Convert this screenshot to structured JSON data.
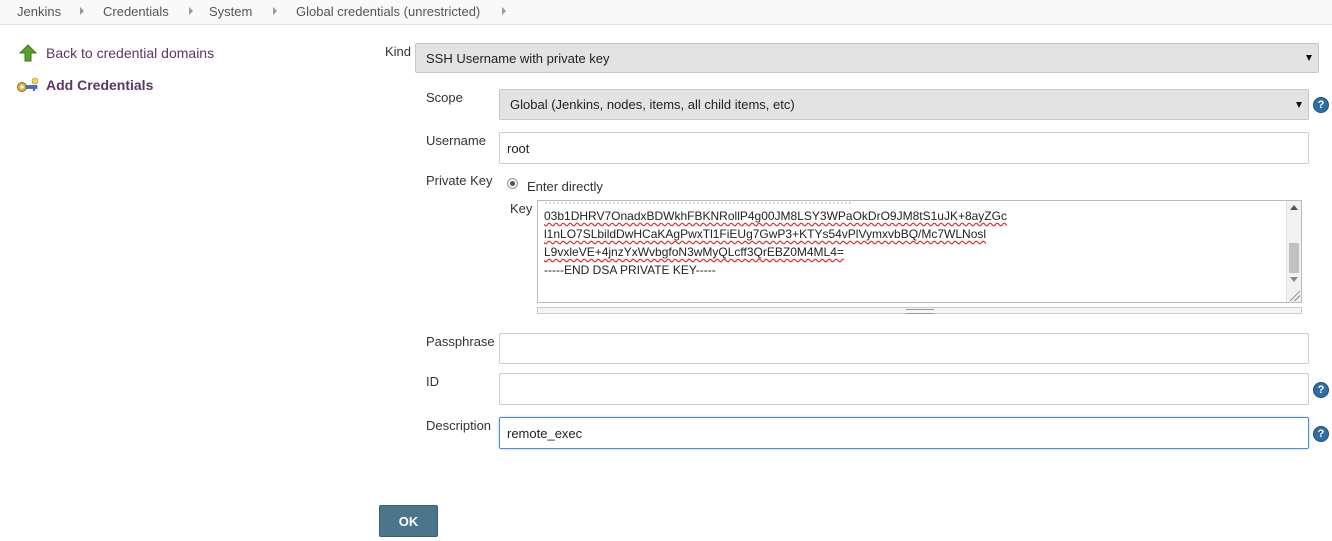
{
  "breadcrumb": [
    "Jenkins",
    "Credentials",
    "System",
    "Global credentials (unrestricted)"
  ],
  "sidebar": {
    "back_label": "Back to credential domains",
    "add_label": "Add Credentials"
  },
  "form": {
    "kind": {
      "label": "Kind",
      "value": "SSH Username with private key"
    },
    "scope": {
      "label": "Scope",
      "value": "Global (Jenkins, nodes, items, all child items, etc)"
    },
    "username": {
      "label": "Username",
      "value": "root"
    },
    "private_key": {
      "label": "Private Key",
      "option_label": "Enter directly",
      "key_label": "Key",
      "key_lines": [
        "03b1DHRV7OnadxBDWkhFBKNRollP4g00JM8LSY3WPaOkDrO9JM8tS1uJK+8ayZGc",
        "l1nLO7SLbildDwHCaKAgPwxTl1FiEUg7GwP3+KTYs54vPlVymxvbBQ/Mc7WLNosl",
        "L9vxleVE+4jnzYxWvbgfoN3wMyQLcff3QrEBZ0M4ML4=",
        "-----END DSA PRIVATE KEY-----"
      ]
    },
    "passphrase": {
      "label": "Passphrase",
      "value": ""
    },
    "id": {
      "label": "ID",
      "value": ""
    },
    "description": {
      "label": "Description",
      "value": "remote_exec"
    },
    "help_glyph": "?",
    "ok_label": "OK"
  },
  "colors": {
    "link": "#5c3566",
    "button": "#4b758b",
    "help": "#2e6ea6",
    "focus": "#4a90d9"
  },
  "icons": [
    "up-arrow-icon",
    "key-icon",
    "help-icon",
    "dropdown-arrow-icon",
    "breadcrumb-chevron-icon"
  ]
}
